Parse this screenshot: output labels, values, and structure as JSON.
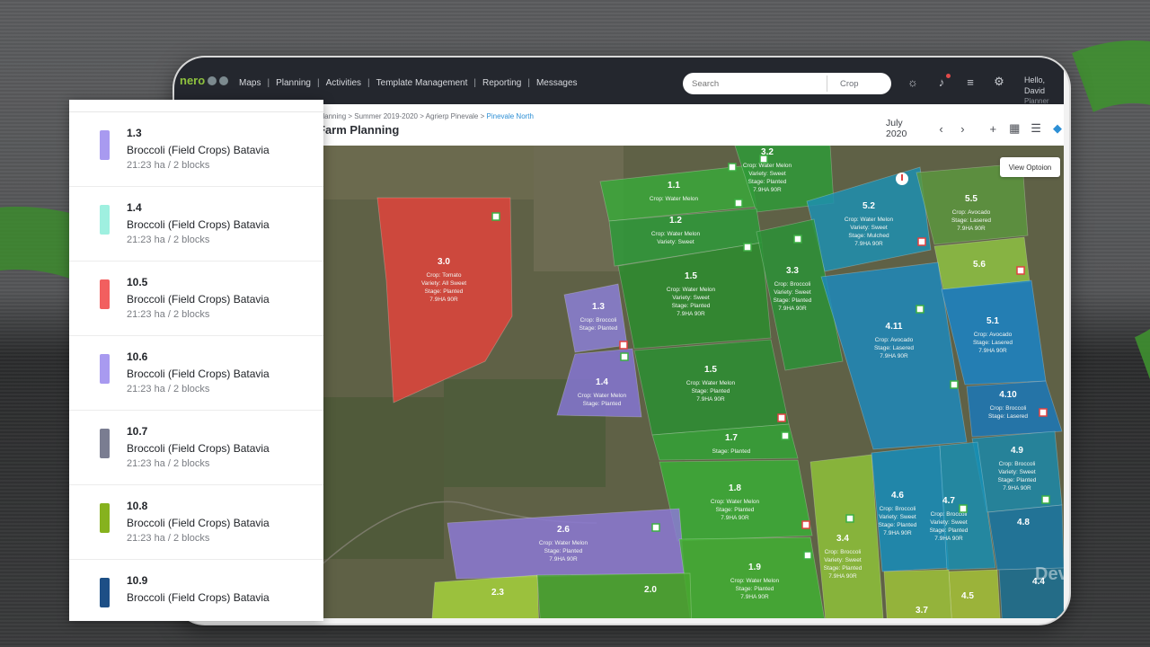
{
  "app": {
    "logo_text": "nero",
    "nav": [
      "Maps",
      "Planning",
      "Activities",
      "Template Management",
      "Reporting",
      "Messages"
    ],
    "search_placeholder": "Search",
    "search_filter": "Crop",
    "greeting": "Hello, David",
    "role": "Planner"
  },
  "subheader": {
    "breadcrumb": [
      "Planning",
      "Summer 2019-2020",
      "Agrierp Pinevale"
    ],
    "breadcrumb_active": "Pinevale North",
    "title": "Farm Planning",
    "month": "July 2020",
    "prev": "‹",
    "next": "›",
    "add": "+",
    "calendar": "▦",
    "list": "☰",
    "map": "◆"
  },
  "map": {
    "view_options": "View Optoion",
    "watermark": "Dev",
    "plots": [
      {
        "id": "3.0",
        "lines": [
          "Crop: Tomato",
          "Variety: All Sweet",
          "Stage: Planted",
          "7.9HA 90R"
        ]
      },
      {
        "id": "1.1",
        "lines": [
          "Crop: Water Melon"
        ]
      },
      {
        "id": "3.2",
        "lines": [
          "Crop: Water Melon",
          "Variety: Sweet",
          "Stage: Planted",
          "7.9HA 90R"
        ]
      },
      {
        "id": "1.2",
        "lines": [
          "Crop: Water Melon",
          "Variety: Sweet"
        ]
      },
      {
        "id": "5.2",
        "lines": [
          "Crop: Water Melon",
          "Variety: Sweet",
          "Stage: Mulched",
          "7.9HA 90R"
        ]
      },
      {
        "id": "5.5",
        "lines": [
          "Crop: Avocado",
          "Stage: Lasered",
          "7.9HA 90R"
        ]
      },
      {
        "id": "1.5",
        "lines": [
          "Crop: Water Melon",
          "Variety: Sweet",
          "Stage: Planted",
          "7.9HA 90R"
        ]
      },
      {
        "id": "3.3",
        "lines": [
          "Crop: Broccoli",
          "Variety: Sweet",
          "Stage: Planted",
          "7.9HA 90R"
        ]
      },
      {
        "id": "5.6",
        "lines": []
      },
      {
        "id": "1.3",
        "lines": [
          "Crop: Broccoli",
          "Stage: Planted"
        ]
      },
      {
        "id": "4.11",
        "lines": [
          "Crop: Avocado",
          "Stage: Lasered",
          "7.9HA 90R"
        ]
      },
      {
        "id": "5.1",
        "lines": [
          "Crop: Avocado",
          "Stage: Lasered",
          "7.9HA 90R"
        ]
      },
      {
        "id": "1.4",
        "lines": [
          "Crop: Water Melon",
          "Stage: Planted"
        ]
      },
      {
        "id": "1.5b",
        "label": "1.5",
        "lines": [
          "Crop: Water Melon",
          "Stage: Planted",
          "7.9HA 90R"
        ]
      },
      {
        "id": "4.10",
        "lines": [
          "Crop: Broccoli",
          "Stage: Lasered"
        ]
      },
      {
        "id": "1.7",
        "lines": [
          "Stage: Planted"
        ]
      },
      {
        "id": "4.9",
        "lines": [
          "Crop: Broccoli",
          "Variety: Sweet",
          "Stage: Planted",
          "7.9HA 90R"
        ]
      },
      {
        "id": "1.8",
        "lines": [
          "Crop: Water Melon",
          "Stage: Planted",
          "7.9HA 90R"
        ]
      },
      {
        "id": "4.6",
        "lines": [
          "Crop: Broccoli",
          "Variety: Sweet",
          "Stage: Planted",
          "7.9HA 90R"
        ]
      },
      {
        "id": "4.7",
        "lines": [
          "Crop: Broccoli",
          "Variety: Sweet",
          "Stage: Planted",
          "7.9HA 90R"
        ]
      },
      {
        "id": "4.8",
        "lines": []
      },
      {
        "id": "2.6",
        "lines": [
          "Crop: Water Melon",
          "Stage: Planted",
          "7.9HA 90R"
        ]
      },
      {
        "id": "3.4",
        "lines": [
          "Crop: Broccoli",
          "Variety: Sweet",
          "Stage: Planted",
          "7.9HA 90R"
        ]
      },
      {
        "id": "1.9",
        "lines": [
          "Crop: Water Melon",
          "Stage: Planted",
          "7.9HA 90R"
        ]
      },
      {
        "id": "2.3",
        "lines": []
      },
      {
        "id": "2.0",
        "lines": []
      },
      {
        "id": "4.5",
        "lines": []
      },
      {
        "id": "3.7",
        "lines": []
      },
      {
        "id": "4.4",
        "lines": []
      }
    ]
  },
  "panel": {
    "items": [
      {
        "num": "1.3",
        "name": "Broccoli (Field Crops) Batavia",
        "meta": "21:23 ha / 2 blocks",
        "color": "#a89af0"
      },
      {
        "num": "1.4",
        "name": "Broccoli (Field Crops) Batavia",
        "meta": "21:23 ha / 2 blocks",
        "color": "#9ff0e0"
      },
      {
        "num": "10.5",
        "name": "Broccoli (Field Crops) Batavia",
        "meta": "21:23 ha / 2 blocks",
        "color": "#f25f5f"
      },
      {
        "num": "10.6",
        "name": "Broccoli (Field Crops) Batavia",
        "meta": "21:23 ha / 2 blocks",
        "color": "#a89af0"
      },
      {
        "num": "10.7",
        "name": "Broccoli (Field Crops) Batavia",
        "meta": "21:23 ha / 2 blocks",
        "color": "#7a7d91"
      },
      {
        "num": "10.8",
        "name": "Broccoli (Field Crops) Batavia",
        "meta": "21:23 ha / 2 blocks",
        "color": "#86b21e"
      },
      {
        "num": "10.9",
        "name": "Broccoli (Field Crops) Batavia",
        "meta": "",
        "color": "#1d4f86"
      }
    ]
  }
}
